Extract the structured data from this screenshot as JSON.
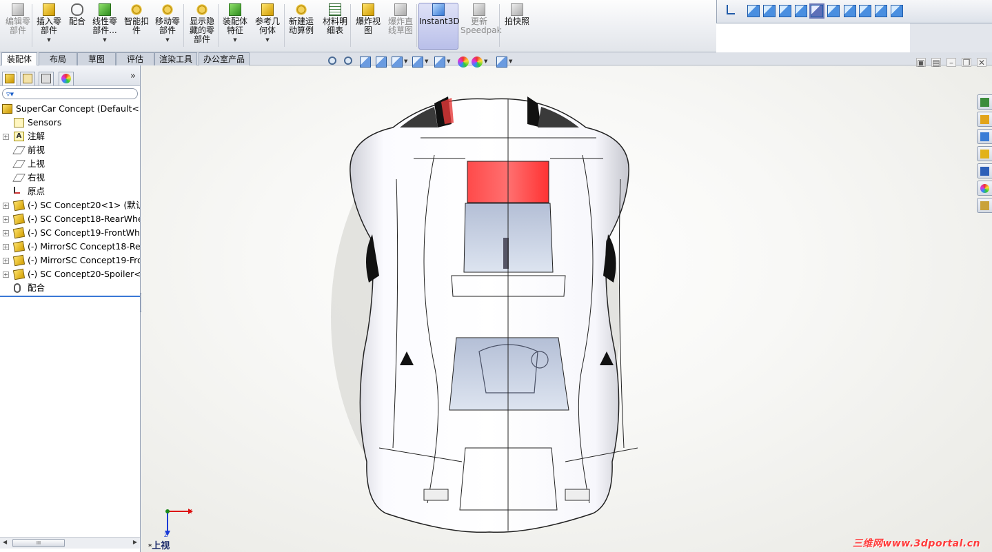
{
  "ribbon": {
    "buttons": [
      {
        "label": "编辑零\n部件",
        "disabled": true,
        "icon": "edit-component-icon"
      },
      {
        "label": "插入零\n部件",
        "dropdown": true,
        "icon": "insert-components-icon"
      },
      {
        "label": "配合",
        "icon": "mate-icon"
      },
      {
        "label": "线性零\n部件...",
        "dropdown": true,
        "icon": "linear-pattern-icon"
      },
      {
        "label": "智能扣\n件",
        "icon": "smart-fasteners-icon"
      },
      {
        "label": "移动零\n部件",
        "dropdown": true,
        "icon": "move-component-icon"
      },
      {
        "label": "显示隐\n藏的零\n部件",
        "icon": "show-hidden-components-icon"
      },
      {
        "label": "装配体\n特征",
        "dropdown": true,
        "icon": "assembly-features-icon"
      },
      {
        "label": "参考几\n何体",
        "dropdown": true,
        "icon": "reference-geometry-icon"
      },
      {
        "label": "新建运\n动算例",
        "icon": "new-motion-study-icon"
      },
      {
        "label": "材料明\n细表",
        "icon": "bill-of-materials-icon"
      },
      {
        "label": "爆炸视\n图",
        "icon": "exploded-view-icon"
      },
      {
        "label": "爆炸直\n线草图",
        "disabled": true,
        "icon": "explode-line-sketch-icon"
      },
      {
        "label": "Instant3D",
        "active": true,
        "icon": "instant3d-icon"
      },
      {
        "label": "更新\nSpeedpak",
        "disabled": true,
        "icon": "update-speedpak-icon"
      },
      {
        "label": "拍快照",
        "icon": "take-snapshot-icon"
      }
    ]
  },
  "viewbar": {
    "icons": [
      "normal-to-icon",
      "front-view-icon",
      "back-view-icon",
      "left-view-icon",
      "right-view-icon",
      "top-view-icon",
      "bottom-view-icon",
      "isometric-icon",
      "trimetric-icon",
      "dimetric-icon",
      "view-selector-icon"
    ],
    "selected_index": 5
  },
  "tabs": [
    "装配体",
    "布局",
    "草图",
    "评估",
    "渲染工具",
    "办公室产品"
  ],
  "active_tab": 0,
  "featuremanager": {
    "tabs": [
      "feature-manager-icon",
      "property-manager-icon",
      "configuration-manager-icon",
      "display-manager-icon"
    ],
    "more": "»",
    "filter_icon": "filter-icon",
    "tree": [
      {
        "label": "SuperCar Concept  (Default<D",
        "icon": "assembly-icon",
        "expander": false,
        "indent": 0
      },
      {
        "label": "Sensors",
        "icon": "sensors-icon",
        "expander": false,
        "indent": 1
      },
      {
        "label": "注解",
        "icon": "annotations-icon",
        "expander": true,
        "indent": 1
      },
      {
        "label": "前视",
        "icon": "plane-icon",
        "expander": false,
        "indent": 1
      },
      {
        "label": "上视",
        "icon": "plane-icon",
        "expander": false,
        "indent": 1
      },
      {
        "label": "右视",
        "icon": "plane-icon",
        "expander": false,
        "indent": 1
      },
      {
        "label": "原点",
        "icon": "origin-icon",
        "expander": false,
        "indent": 1
      },
      {
        "label": "(-) SC Concept20<1> (默认<",
        "icon": "part-icon",
        "expander": true,
        "indent": 1
      },
      {
        "label": "(-) SC Concept18-RearWhee",
        "icon": "part-icon",
        "expander": true,
        "indent": 1
      },
      {
        "label": "(-) SC Concept19-FrontWhe",
        "icon": "part-icon",
        "expander": true,
        "indent": 1
      },
      {
        "label": "(-) MirrorSC Concept18-Rea",
        "icon": "part-icon",
        "expander": true,
        "indent": 1
      },
      {
        "label": "(-) MirrorSC Concept19-Fro",
        "icon": "part-icon",
        "expander": true,
        "indent": 1
      },
      {
        "label": "(-) SC Concept20-Spoiler<1",
        "icon": "part-icon",
        "expander": true,
        "indent": 1
      },
      {
        "label": "配合",
        "icon": "mates-icon",
        "expander": false,
        "indent": 1
      }
    ],
    "hscroll_thumb": "III"
  },
  "graphics": {
    "hud_icons": [
      "zoom-to-fit-icon",
      "zoom-to-area-icon",
      "previous-view-icon",
      "section-view-icon",
      "view-orientation-icon",
      "display-style-icon",
      "hide-show-items-icon",
      "edit-appearance-icon",
      "apply-scene-icon",
      "view-settings-icon"
    ],
    "window_controls": [
      "tile-horizontal-icon",
      "tile-vertical-icon",
      "minimize-icon",
      "restore-icon",
      "close-icon"
    ],
    "taskpane_icons": [
      "solidworks-resources-icon",
      "home-icon",
      "design-library-icon",
      "file-explorer-icon",
      "view-palette-icon",
      "appearances-icon",
      "custom-properties-icon"
    ],
    "triad": {
      "x": "X",
      "z": "Z"
    },
    "view_name_star": "*",
    "view_name": "上视",
    "watermark": "三维网www.3dportal.cn"
  }
}
